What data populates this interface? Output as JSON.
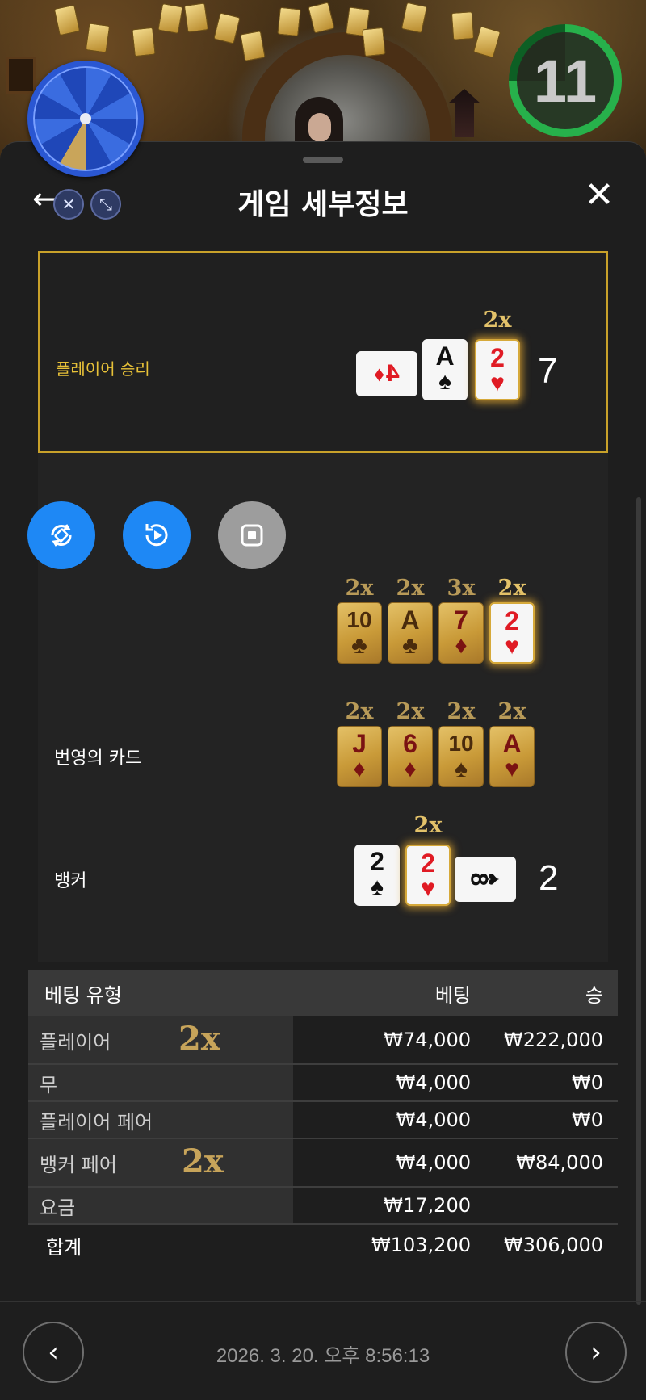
{
  "timer": {
    "value": "11"
  },
  "header": {
    "title": "게임 세부정보",
    "back_icon": "←",
    "close_icon": "✕"
  },
  "player": {
    "label": "플레이어 승리",
    "score": "7",
    "side_card": {
      "rank": "4",
      "suit": "♦",
      "color": "red"
    },
    "cards": [
      {
        "rank": "A",
        "suit": "♠",
        "color": "black",
        "multiplier": ""
      },
      {
        "rank": "2",
        "suit": "♥",
        "color": "red",
        "multiplier": "2x"
      }
    ]
  },
  "lightning": {
    "label": "번영의 카드",
    "rows": [
      [
        {
          "rank": "10",
          "suit": "♣",
          "multiplier": "2x"
        },
        {
          "rank": "A",
          "suit": "♣",
          "multiplier": "2x"
        },
        {
          "rank": "7",
          "suit": "♦",
          "multiplier": "3x"
        },
        {
          "rank": "2",
          "suit": "♥",
          "multiplier": "2x"
        }
      ],
      [
        {
          "rank": "J",
          "suit": "♦",
          "multiplier": "2x"
        },
        {
          "rank": "6",
          "suit": "♦",
          "multiplier": "2x"
        },
        {
          "rank": "10",
          "suit": "♠",
          "multiplier": "2x"
        },
        {
          "rank": "A",
          "suit": "♥",
          "multiplier": "2x"
        }
      ]
    ]
  },
  "banker": {
    "label": "뱅커",
    "score": "2",
    "cards": [
      {
        "rank": "2",
        "suit": "♠",
        "color": "black",
        "multiplier": ""
      },
      {
        "rank": "2",
        "suit": "♥",
        "color": "red",
        "multiplier": "2x"
      }
    ],
    "side_card": {
      "rank": "8",
      "suit": "♠",
      "color": "black"
    }
  },
  "bet_table": {
    "headers": {
      "type": "베팅 유형",
      "bet": "베팅",
      "win": "승"
    },
    "rows": [
      {
        "type": "플레이어",
        "multiplier": "2x",
        "bet": "₩74,000",
        "win": "₩222,000"
      },
      {
        "type": "무",
        "multiplier": "",
        "bet": "₩4,000",
        "win": "₩0"
      },
      {
        "type": "플레이어 페어",
        "multiplier": "",
        "bet": "₩4,000",
        "win": "₩0"
      },
      {
        "type": "뱅커 페어",
        "multiplier": "2x",
        "bet": "₩4,000",
        "win": "₩84,000"
      },
      {
        "type": "요금",
        "multiplier": "",
        "bet": "₩17,200",
        "win": ""
      }
    ],
    "total": {
      "type": "합계",
      "bet": "₩103,200",
      "win": "₩306,000"
    }
  },
  "footer": {
    "timestamp": "2026. 3. 20. 오후 8:56:13",
    "prev_icon": "‹",
    "next_icon": "›"
  },
  "colors": {
    "accent_gold": "#e7c138",
    "video_blue": "#1e88f5",
    "timer_green": "#27b14b"
  }
}
